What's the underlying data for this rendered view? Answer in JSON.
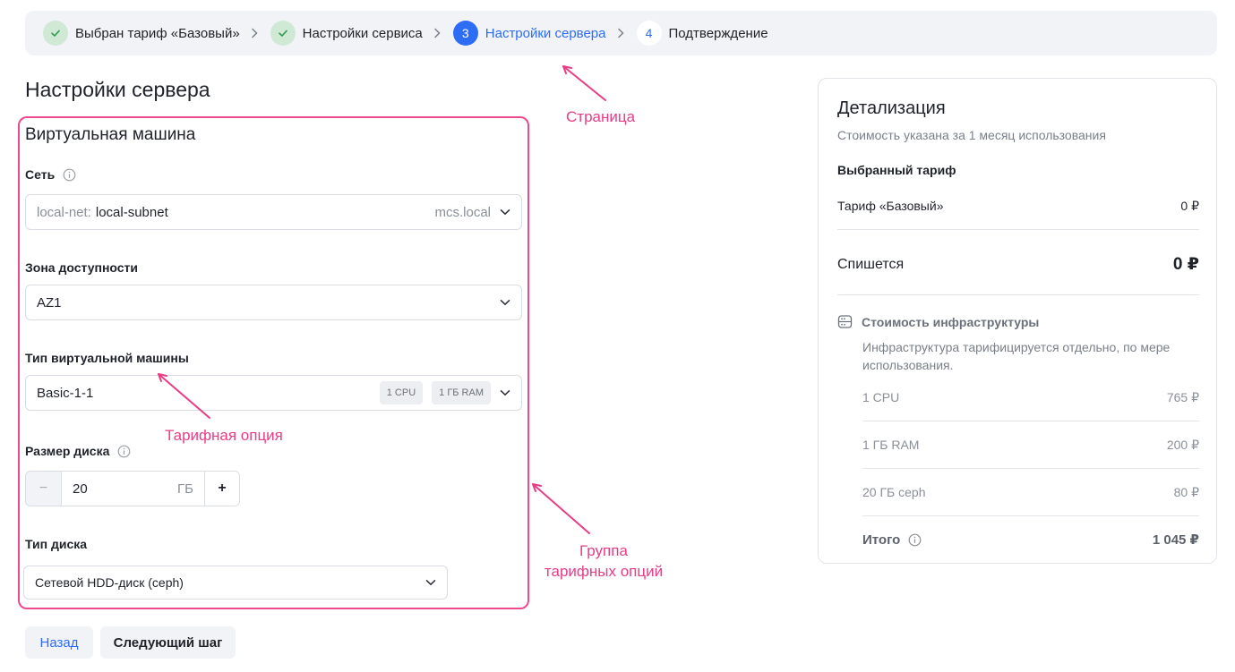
{
  "stepper": {
    "steps": [
      {
        "num": "✓",
        "label": "Выбран тариф «Базовый»",
        "state": "done"
      },
      {
        "num": "✓",
        "label": "Настройки сервиса",
        "state": "done"
      },
      {
        "num": "3",
        "label": "Настройки сервера",
        "state": "active"
      },
      {
        "num": "4",
        "label": "Подтверждение",
        "state": "todo"
      }
    ]
  },
  "page_title": "Настройки сервера",
  "section_title": "Виртуальная машина",
  "fields": {
    "network": {
      "label": "Сеть",
      "prefix": "local-net:",
      "value": "local-subnet",
      "domain": "mcs.local"
    },
    "zone": {
      "label": "Зона доступности",
      "value": "AZ1"
    },
    "vm_type": {
      "label": "Тип виртуальной машины",
      "value": "Basic-1-1",
      "chip_cpu": "1 CPU",
      "chip_ram": "1 ГБ RAM"
    },
    "disk_size": {
      "label": "Размер диска",
      "value": "20",
      "unit": "ГБ",
      "minus": "−",
      "plus": "+"
    },
    "disk_type": {
      "label": "Тип диска",
      "value": "Сетевой HDD-диск (ceph)"
    }
  },
  "buttons": {
    "back": "Назад",
    "next": "Следующий шаг"
  },
  "annotations": {
    "page": "Страница",
    "tariff_option": "Тарифная опция",
    "group_line1": "Группа",
    "group_line2": "тарифных опций"
  },
  "details": {
    "title": "Детализация",
    "subtitle": "Стоимость указана за 1 месяц использования",
    "selected_heading": "Выбранный тариф",
    "tariff_label": "Тариф «Базовый»",
    "tariff_price": "0 ₽",
    "charge_label": "Спишется",
    "charge_value": "0 ₽",
    "infra_heading": "Стоимость инфраструктуры",
    "infra_text": "Инфраструктура тарифицируется отдельно, по мере использования.",
    "infra_rows": [
      {
        "label": "1 CPU",
        "price": "765 ₽"
      },
      {
        "label": "1 ГБ RAM",
        "price": "200 ₽"
      },
      {
        "label": "20 ГБ ceph",
        "price": "80 ₽"
      }
    ],
    "total_label": "Итого",
    "total_value": "1 045 ₽"
  },
  "colors": {
    "accent": "#2d6df6",
    "annotation": "#e73d86",
    "done_bg": "#cfe9d5",
    "done_fg": "#2e9a4a"
  }
}
